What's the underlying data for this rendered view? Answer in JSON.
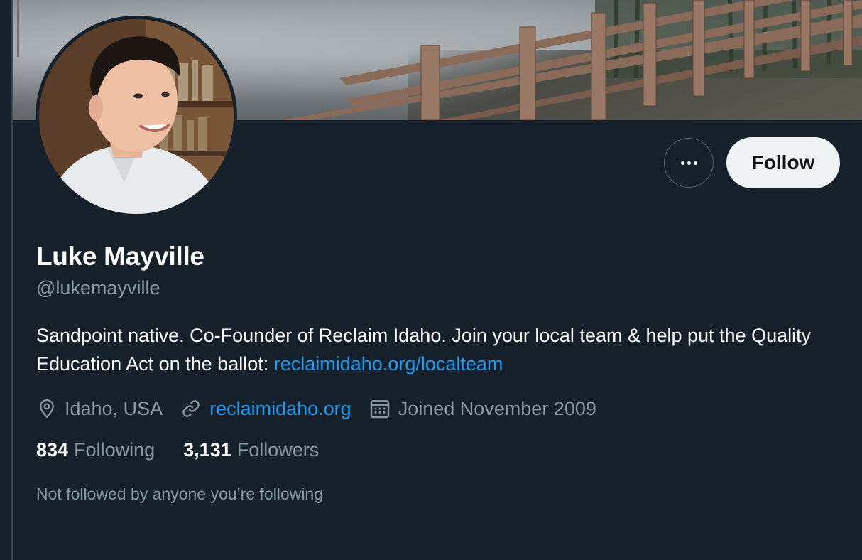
{
  "profile": {
    "name": "Luke Mayville",
    "handle": "@lukemayville",
    "bio_text": "Sandpoint native. Co-Founder of Reclaim Idaho. Join your local team & help put the Quality Education Act on the ballot: ",
    "bio_link": "reclaimidaho.org/localteam",
    "location": "Idaho, USA",
    "website": "reclaimidaho.org",
    "joined": "Joined November 2009",
    "following_count": "834",
    "following_label": "Following",
    "followers_count": "3,131",
    "followers_label": "Followers",
    "not_followed_text": "Not followed by anyone you’re following"
  },
  "actions": {
    "follow_label": "Follow",
    "more_icon": "more-horizontal-icon"
  },
  "icons": {
    "location": "location-pin-icon",
    "link": "link-icon",
    "calendar": "calendar-icon"
  },
  "colors": {
    "background": "#15202b",
    "primary_text": "#ffffff",
    "secondary_text": "#8b98a5",
    "link": "#1d9bf0",
    "follow_button_bg": "#eff3f4"
  }
}
